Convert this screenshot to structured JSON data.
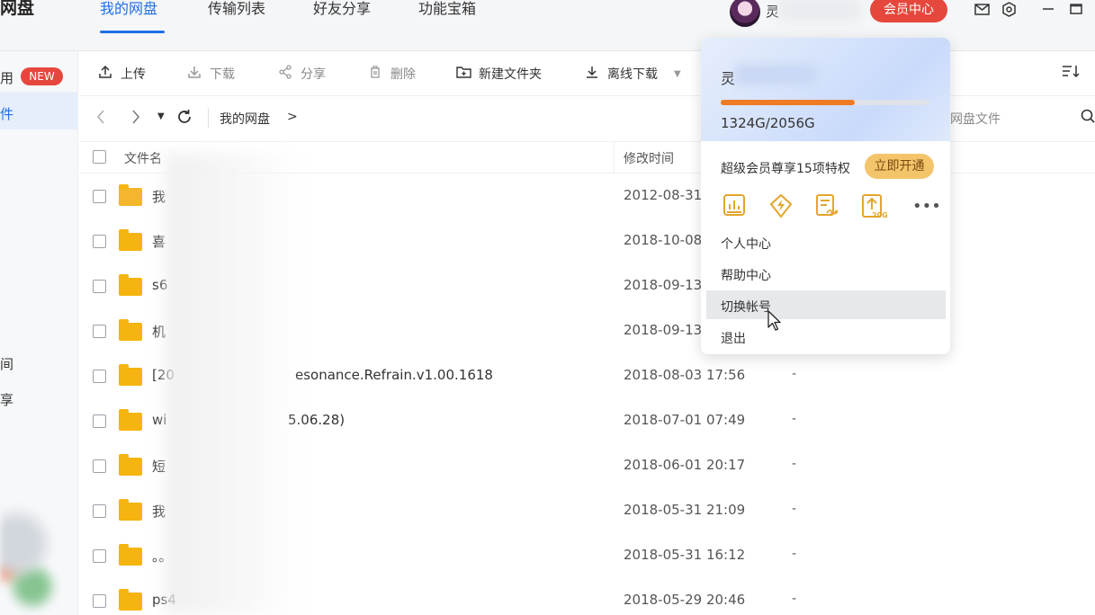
{
  "app": {
    "brand": "网盘"
  },
  "nav": {
    "tabs": [
      {
        "label": "我的网盘",
        "active": true
      },
      {
        "label": "传输列表",
        "active": false
      },
      {
        "label": "好友分享",
        "active": false
      },
      {
        "label": "功能宝箱",
        "active": false
      }
    ]
  },
  "header": {
    "user_name_visible": "灵",
    "vip_center": "会员中心",
    "mail_icon": "mail-icon",
    "settings_icon": "settings-icon",
    "minimize_icon": "minimize-icon",
    "maximize_icon": "maximize-icon"
  },
  "sidebar": {
    "items": [
      {
        "label": "用",
        "badge": "NEW"
      },
      {
        "label": "件",
        "active": true
      },
      {
        "label": "间"
      },
      {
        "label": "享"
      }
    ]
  },
  "toolbar": {
    "upload": "上传",
    "download": "下载",
    "share": "分享",
    "delete": "删除",
    "new_folder": "新建文件夹",
    "offline_download": "离线下载"
  },
  "breadcrumb": {
    "root": "我的网盘",
    "separator": ">"
  },
  "search": {
    "placeholder": "网盘文件"
  },
  "table": {
    "headers": {
      "name": "文件名",
      "modified": "修改时间"
    },
    "rows": [
      {
        "name": "我",
        "date": "2012-08-31",
        "size": ""
      },
      {
        "name": "喜",
        "date": "2018-10-08",
        "size": ""
      },
      {
        "name": "s6",
        "date": "2018-09-13",
        "size": ""
      },
      {
        "name": "机",
        "date": "2018-09-13",
        "size": ""
      },
      {
        "name": "[20",
        "name_tail": "esonance.Refrain.v1.00.1618",
        "date": "2018-08-03 17:56",
        "size": "-"
      },
      {
        "name": "wi",
        "name_tail": "5.06.28)",
        "date": "2018-07-01 07:49",
        "size": "-"
      },
      {
        "name": "短",
        "date": "2018-06-01 20:17",
        "size": "-"
      },
      {
        "name": "我",
        "date": "2018-05-31 21:09",
        "size": "-"
      },
      {
        "name": "。。",
        "date": "2018-05-31 16:12",
        "size": "-"
      },
      {
        "name": "ps4",
        "date": "2018-05-29 20:46",
        "size": "-"
      }
    ]
  },
  "dropdown": {
    "user_initial": "灵",
    "quota_text": "1324G/2056G",
    "quota_fraction": 0.644,
    "vip_text": "超级会员尊享15项特权",
    "open_btn": "立即开通",
    "perk_badge": "20G",
    "menu": [
      "个人中心",
      "帮助中心",
      "切换帐号",
      "退出"
    ],
    "hovered_index": 2
  },
  "colors": {
    "accent": "#1f6fe5",
    "vip_red": "#e6473d",
    "folder": "#f5b40f",
    "quota": "#f07b25",
    "gold": "#f4c46b"
  }
}
